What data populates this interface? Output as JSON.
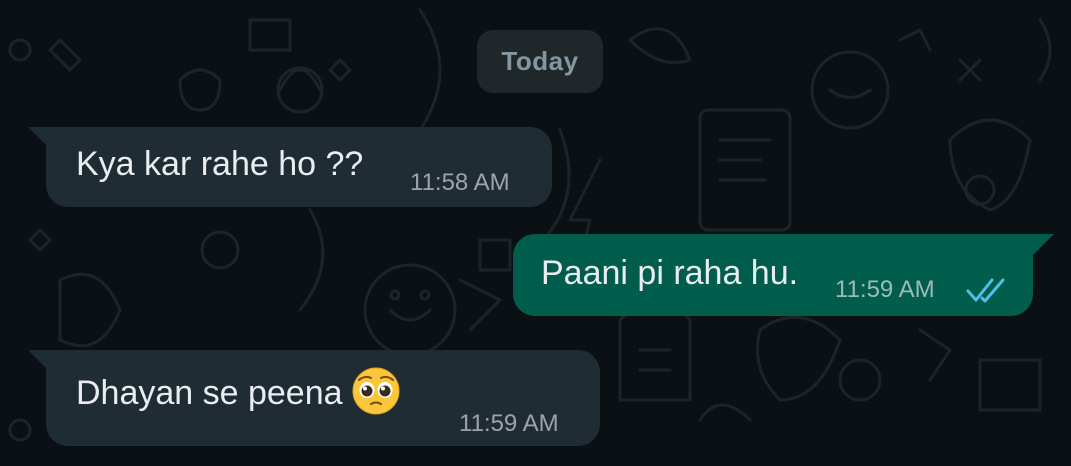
{
  "chat": {
    "date_separator": "Today",
    "messages": [
      {
        "direction": "incoming",
        "text": "Kya kar rahe ho ??",
        "time": "11:58 AM"
      },
      {
        "direction": "outgoing",
        "text": "Paani pi raha hu.",
        "time": "11:59 AM",
        "status": "read",
        "status_icon": "double-check-icon",
        "status_color": "#53bdeb"
      },
      {
        "direction": "incoming",
        "text": "Dhayan se peena",
        "emoji": "pleading-face-emoji",
        "time": "11:59 AM"
      }
    ]
  },
  "colors": {
    "background": "#0b1014",
    "incoming_bubble": "#202c33",
    "outgoing_bubble": "#005c4b",
    "date_chip": "#1f272a",
    "text": "#e9edef",
    "meta_text": "#8696a0",
    "read_ticks": "#53bdeb"
  }
}
